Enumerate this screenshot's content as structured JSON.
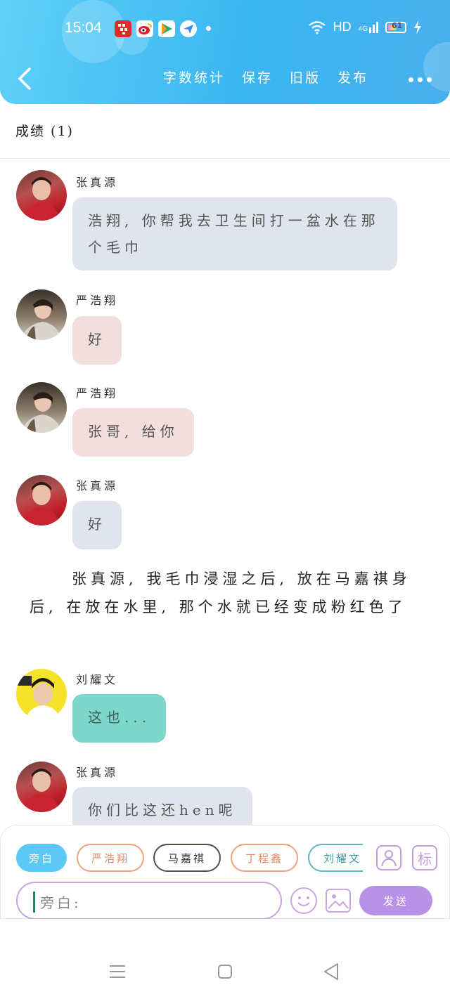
{
  "status_bar": {
    "time": "15:04",
    "network": "HD",
    "signal_label": "4G",
    "battery": "61"
  },
  "header": {
    "menu": [
      "字数统计",
      "保存",
      "旧版",
      "发布"
    ]
  },
  "score_label": "成绩 (1)",
  "messages": [
    {
      "speaker": "张真源",
      "text": "浩翔, 你帮我去卫生间打一盆水在那个毛巾"
    },
    {
      "speaker": "严浩翔",
      "text": "好"
    },
    {
      "speaker": "严浩翔",
      "text": "张哥, 给你"
    },
    {
      "speaker": "张真源",
      "text": "好"
    }
  ],
  "narration": "张真源, 我毛巾浸湿之后, 放在马嘉祺身后, 在放在水里, 那个水就已经变成粉红色了",
  "messages_after": [
    {
      "speaker": "刘耀文",
      "text": "这也..."
    },
    {
      "speaker": "张真源",
      "text": "你们比这还hen呢"
    }
  ],
  "composer": {
    "roles": [
      "旁白",
      "严浩翔",
      "马嘉祺",
      "丁程鑫",
      "刘耀文"
    ],
    "role_colors": [
      "#5cc8f5",
      "#f0a07a",
      "#5a4a46",
      "#f0a07a",
      "#5ab8c0"
    ],
    "tag_label": "标",
    "input_placeholder": "旁白:",
    "send_label": "发送"
  }
}
